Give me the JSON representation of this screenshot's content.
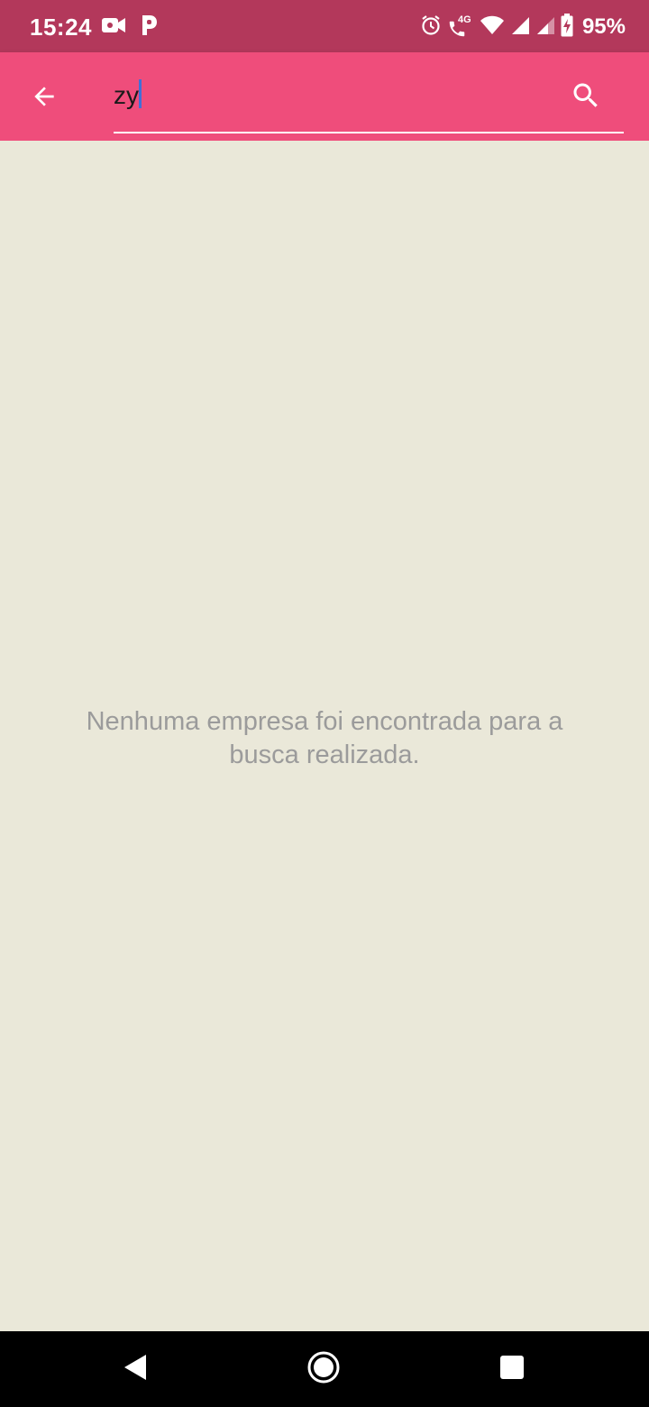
{
  "status_bar": {
    "time": "15:24",
    "network": "4G",
    "battery": "95%",
    "icons": [
      "video-camera-icon",
      "parking-app-icon",
      "alarm-icon",
      "volte-call-icon",
      "wifi-icon",
      "signal-icon",
      "signal-icon-2",
      "battery-charging-icon"
    ]
  },
  "app_bar": {
    "search": {
      "value": "zy"
    },
    "icons": {
      "back": "arrow-back-icon",
      "search": "search-icon"
    }
  },
  "content": {
    "empty_message": "Nenhuma empresa foi encontrada para a busca realizada."
  },
  "nav_bar": {
    "icons": [
      "back-triangle-icon",
      "home-circle-icon",
      "recents-square-icon"
    ]
  },
  "colors": {
    "status_bar": "#B3385B",
    "app_bar": "#EF4D7B",
    "background": "#EAE8D9",
    "empty_text": "#9B9B9B",
    "caret": "#3F6FD8",
    "nav_bar": "#000000"
  }
}
